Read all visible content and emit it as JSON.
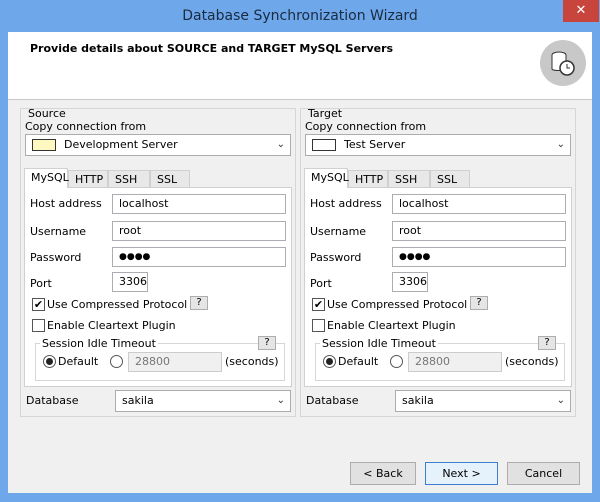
{
  "window": {
    "title": "Database Synchronization Wizard",
    "close_glyph": "✕"
  },
  "header": {
    "text": "Provide details about SOURCE and TARGET MySQL Servers",
    "icon": "database-clock-icon"
  },
  "source": {
    "group_label": "Source",
    "copy_label": "Copy connection from",
    "connection": "Development Server",
    "swatch_color": "#fff8c0",
    "tabs": [
      "MySQL",
      "HTTP",
      "SSH",
      "SSL"
    ],
    "host_label": "Host address",
    "host": "localhost",
    "user_label": "Username",
    "user": "root",
    "pass_label": "Password",
    "pass": "●●●●",
    "port_label": "Port",
    "port": "3306",
    "compressed_label": "Use Compressed Protocol",
    "compressed": true,
    "cleartext_label": "Enable Cleartext Plugin",
    "cleartext": false,
    "timeout_label": "Session Idle Timeout",
    "default_label": "Default",
    "timeout_value": "28800",
    "seconds_label": "(seconds)",
    "help": "?",
    "db_label": "Database",
    "db": "sakila"
  },
  "target": {
    "group_label": "Target",
    "copy_label": "Copy connection from",
    "connection": "Test Server",
    "swatch_color": "#ffffff",
    "tabs": [
      "MySQL",
      "HTTP",
      "SSH",
      "SSL"
    ],
    "host_label": "Host address",
    "host": "localhost",
    "user_label": "Username",
    "user": "root",
    "pass_label": "Password",
    "pass": "●●●●",
    "port_label": "Port",
    "port": "3306",
    "compressed_label": "Use Compressed Protocol",
    "compressed": true,
    "cleartext_label": "Enable Cleartext Plugin",
    "cleartext": false,
    "timeout_label": "Session Idle Timeout",
    "default_label": "Default",
    "timeout_value": "28800",
    "seconds_label": "(seconds)",
    "help": "?",
    "db_label": "Database",
    "db": "sakila"
  },
  "buttons": {
    "back": "< Back",
    "next": "Next >",
    "cancel": "Cancel"
  }
}
